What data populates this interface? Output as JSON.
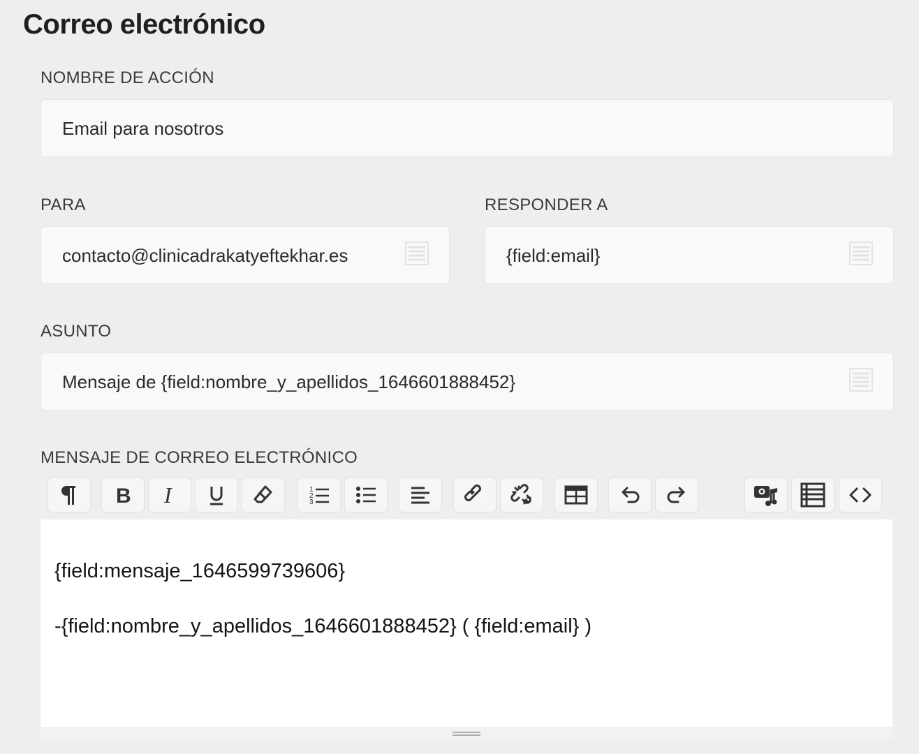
{
  "page": {
    "title": "Correo electrónico"
  },
  "action_name": {
    "label": "NOMBRE DE ACCIÓN",
    "value": "Email para nosotros"
  },
  "to": {
    "label": "PARA",
    "value": "contacto@clinicadrakatyeftekhar.es",
    "icon": "merge-tags-icon"
  },
  "reply_to": {
    "label": "RESPONDER A",
    "value": "{field:email}",
    "icon": "merge-tags-icon"
  },
  "subject": {
    "label": "ASUNTO",
    "value": "Mensaje de {field:nombre_y_apellidos_1646601888452}",
    "icon": "merge-tags-icon"
  },
  "message": {
    "label": "MENSAJE DE CORREO ELECTRÓNICO",
    "toolbar": [
      "paragraph-icon",
      "bold-icon",
      "italic-icon",
      "underline-icon",
      "eraser-icon",
      "ordered-list-icon",
      "unordered-list-icon",
      "align-left-icon",
      "link-icon",
      "unlink-icon",
      "table-icon",
      "undo-icon",
      "redo-icon",
      "media-icon",
      "merge-tags-icon",
      "code-view-icon"
    ],
    "lines": [
      "{field:mensaje_1646599739606}",
      "-{field:nombre_y_apellidos_1646601888452} ( {field:email} )"
    ]
  },
  "colors": {
    "background": "#edeef0",
    "field_bg": "#f9f9f9",
    "editor_bg": "#ffffff",
    "icon": "#333333"
  }
}
